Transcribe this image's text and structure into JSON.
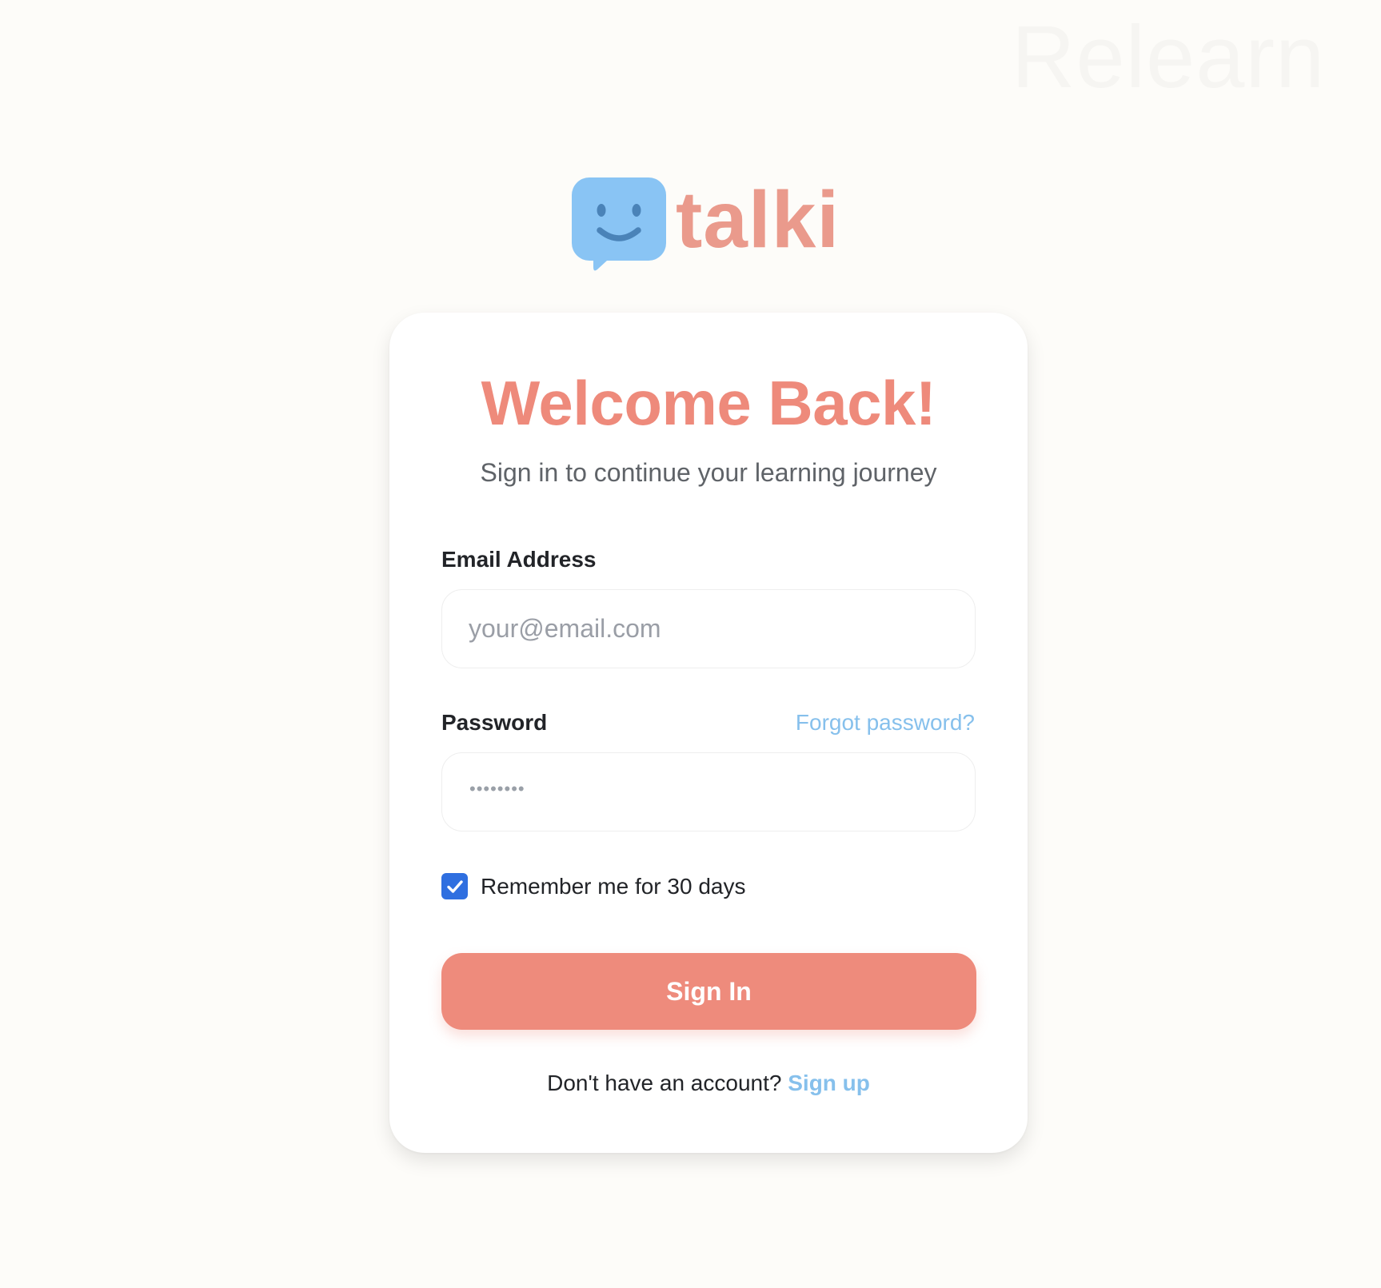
{
  "watermark": "Relearn",
  "brand": {
    "name": "talki",
    "icon": "smiling-speech-bubble-icon",
    "icon_color": "#89C4F4",
    "text_color": "#EA9A8C"
  },
  "login": {
    "title": "Welcome Back!",
    "subtitle": "Sign in to continue your learning journey",
    "email": {
      "label": "Email Address",
      "placeholder": "your@email.com",
      "value": ""
    },
    "password": {
      "label": "Password",
      "placeholder": "••••••••",
      "value": "",
      "forgot_label": "Forgot password?"
    },
    "remember": {
      "label": "Remember me for 30 days",
      "checked": true
    },
    "submit_label": "Sign In",
    "signup_prompt": "Don't have an account?",
    "signup_link": "Sign up"
  },
  "colors": {
    "accent": "#EE8B7C",
    "link": "#86C0EC",
    "checkbox": "#2F6FE0",
    "background": "#FDFCF9"
  }
}
